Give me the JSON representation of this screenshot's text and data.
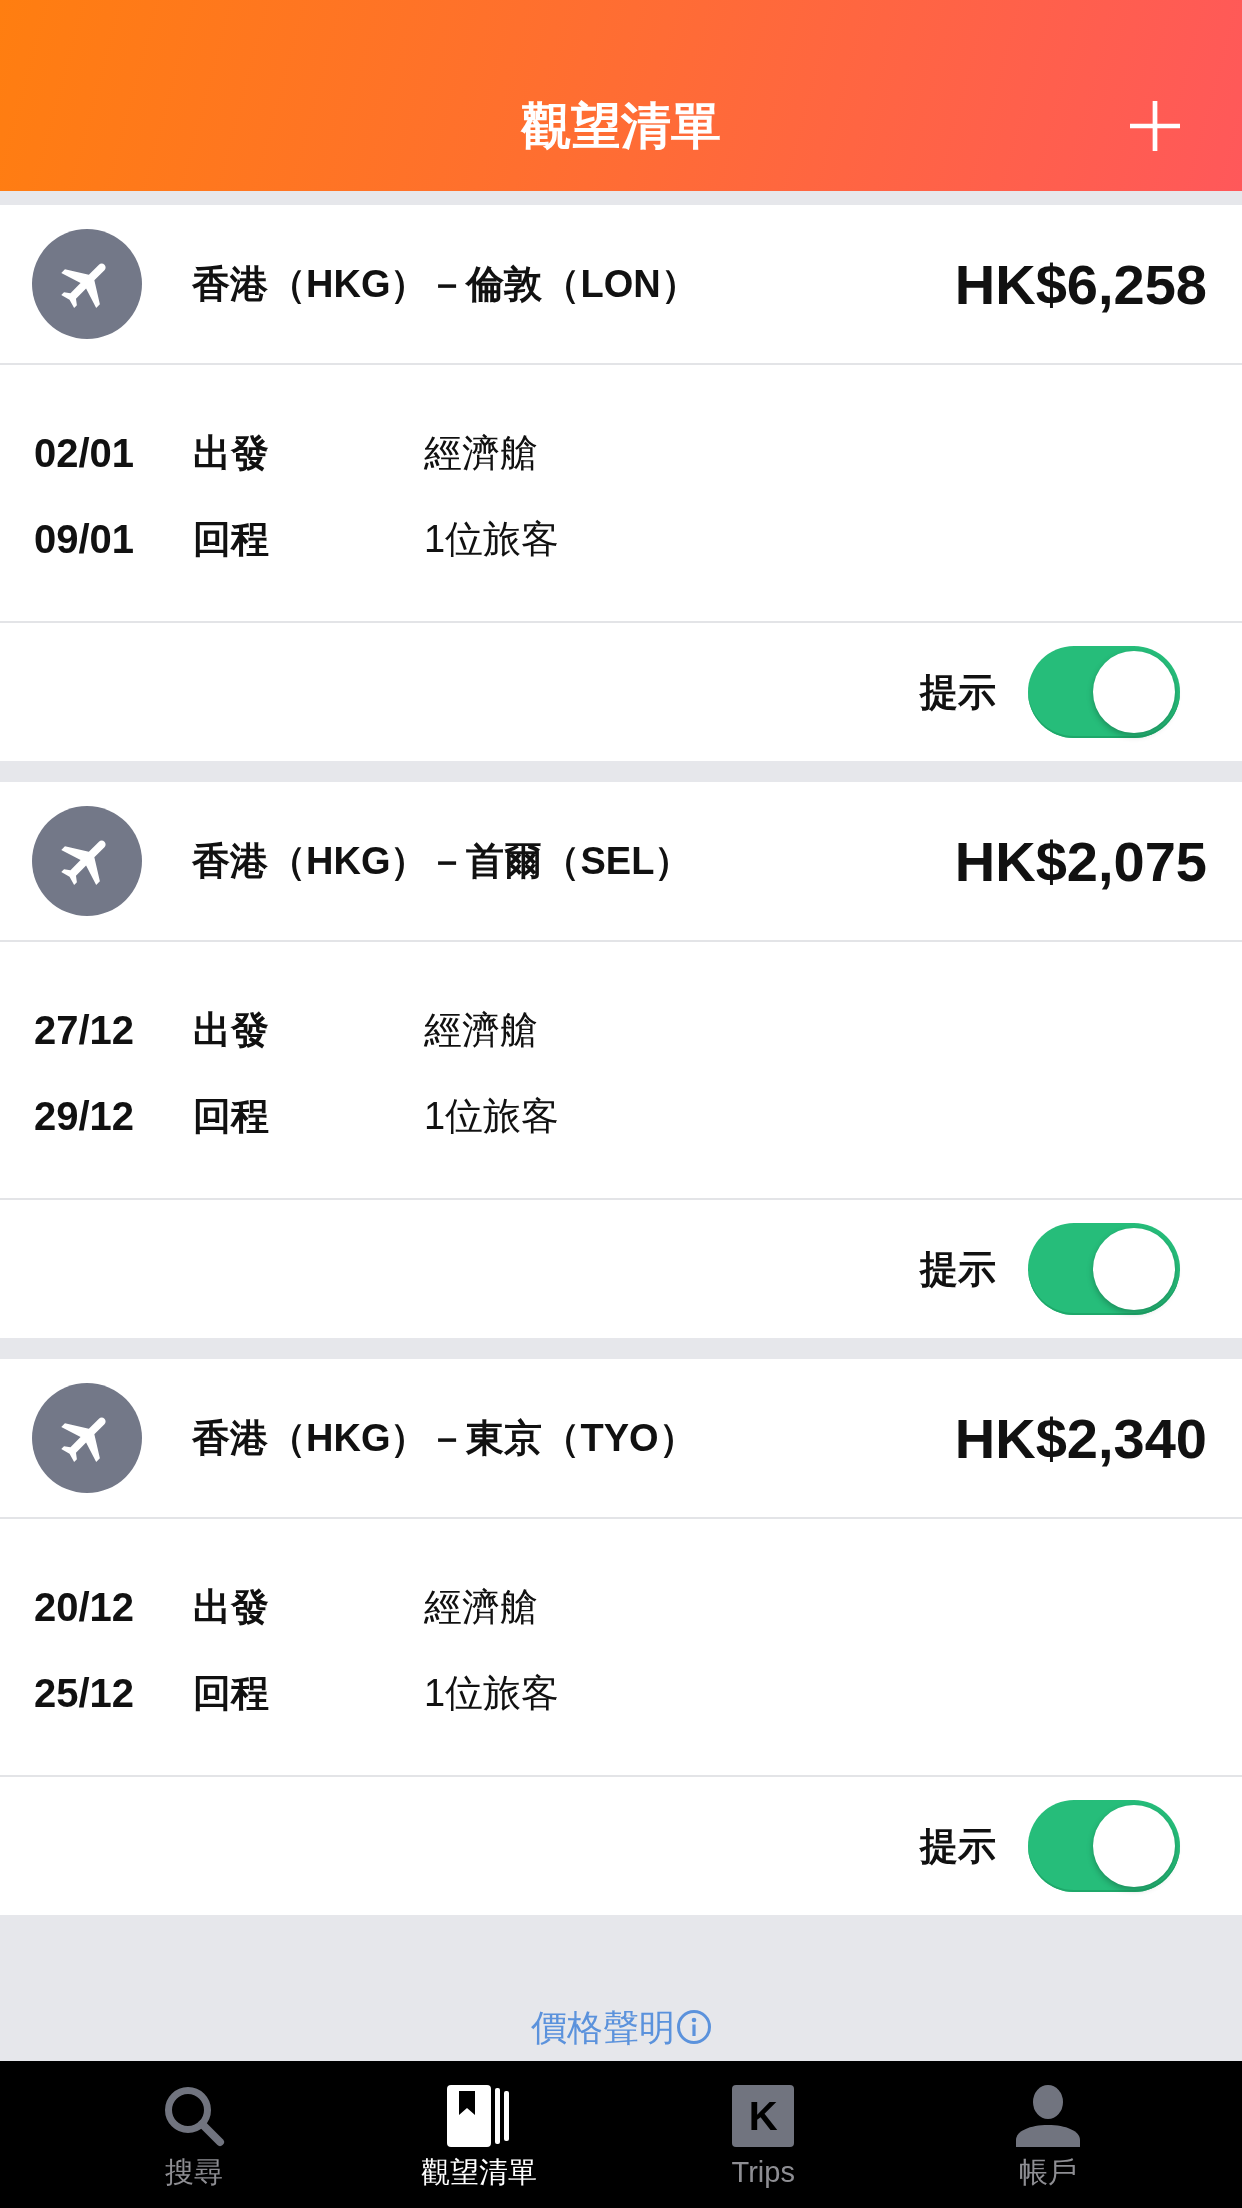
{
  "header": {
    "title": "觀望清單"
  },
  "watchlist": [
    {
      "route": "香港（HKG）－倫敦（LON）",
      "price": "HK$6,258",
      "rows": [
        {
          "date": "02/01",
          "direction": "出發",
          "detail": "經濟艙"
        },
        {
          "date": "09/01",
          "direction": "回程",
          "detail": "1位旅客"
        }
      ],
      "alert": {
        "label": "提示",
        "on": true
      }
    },
    {
      "route": "香港（HKG）－首爾（SEL）",
      "price": "HK$2,075",
      "rows": [
        {
          "date": "27/12",
          "direction": "出發",
          "detail": "經濟艙"
        },
        {
          "date": "29/12",
          "direction": "回程",
          "detail": "1位旅客"
        }
      ],
      "alert": {
        "label": "提示",
        "on": true
      }
    },
    {
      "route": "香港（HKG）－東京（TYO）",
      "price": "HK$2,340",
      "rows": [
        {
          "date": "20/12",
          "direction": "出發",
          "detail": "經濟艙"
        },
        {
          "date": "25/12",
          "direction": "回程",
          "detail": "1位旅客"
        }
      ],
      "alert": {
        "label": "提示",
        "on": true
      }
    }
  ],
  "footer_link": {
    "label": "價格聲明"
  },
  "tab_bar": {
    "tabs": [
      {
        "kind": "search",
        "label": "搜尋",
        "selected": false
      },
      {
        "kind": "watchlist",
        "label": "觀望清單",
        "selected": true
      },
      {
        "kind": "trips",
        "label": "Trips",
        "icon_letter": "K",
        "selected": false
      },
      {
        "kind": "account",
        "label": "帳戶",
        "selected": false
      }
    ]
  }
}
